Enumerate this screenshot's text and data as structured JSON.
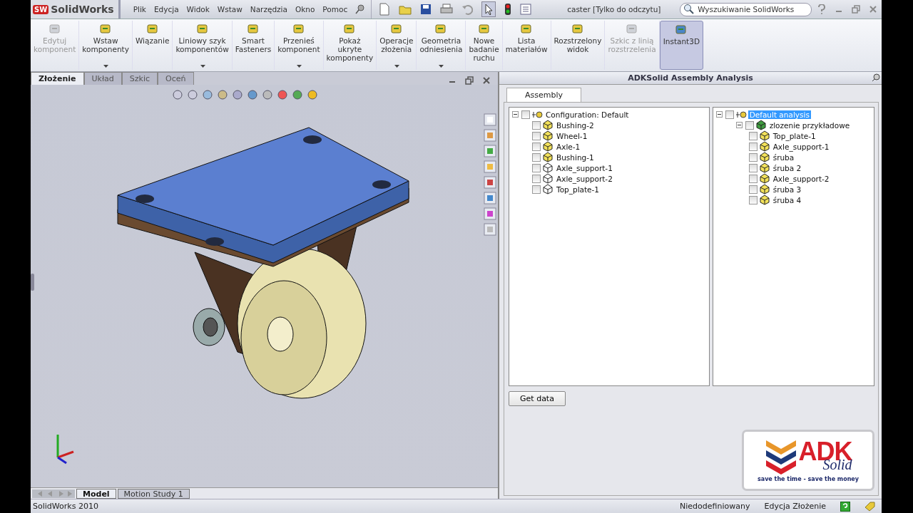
{
  "app": {
    "logo_badge": "SW",
    "logo": "SolidWorks",
    "menu": [
      "Plik",
      "Edycja",
      "Widok",
      "Wstaw",
      "Narzędzia",
      "Okno",
      "Pomoc"
    ],
    "title": "caster [Tylko do odczytu]",
    "search": {
      "placeholder": "Wyszukiwanie SolidWorks"
    }
  },
  "ribbon": [
    {
      "lines": [
        "Edytuj",
        "komponent"
      ],
      "disabled": true,
      "dropdown": false,
      "selected": false
    },
    {
      "lines": [
        "Wstaw",
        "komponenty"
      ],
      "disabled": false,
      "dropdown": true,
      "selected": false
    },
    {
      "lines": [
        "Wiązanie"
      ],
      "disabled": false,
      "dropdown": false,
      "selected": false
    },
    {
      "lines": [
        "Liniowy szyk",
        "komponentów"
      ],
      "disabled": false,
      "dropdown": true,
      "selected": false
    },
    {
      "lines": [
        "Smart",
        "Fasteners"
      ],
      "disabled": false,
      "dropdown": false,
      "selected": false
    },
    {
      "lines": [
        "Przenieś",
        "komponent"
      ],
      "disabled": false,
      "dropdown": true,
      "selected": false
    },
    {
      "lines": [
        "Pokaż",
        "ukryte",
        "komponenty"
      ],
      "disabled": false,
      "dropdown": false,
      "selected": false
    },
    {
      "lines": [
        "Operacje",
        "złożenia"
      ],
      "disabled": false,
      "dropdown": true,
      "selected": false
    },
    {
      "lines": [
        "Geometria",
        "odniesienia"
      ],
      "disabled": false,
      "dropdown": true,
      "selected": false
    },
    {
      "lines": [
        "Nowe",
        "badanie",
        "ruchu"
      ],
      "disabled": false,
      "dropdown": false,
      "selected": false
    },
    {
      "lines": [
        "Lista",
        "materiałów"
      ],
      "disabled": false,
      "dropdown": false,
      "selected": false
    },
    {
      "lines": [
        "Rozstrzelony",
        "widok"
      ],
      "disabled": false,
      "dropdown": false,
      "selected": false
    },
    {
      "lines": [
        "Szkic z linią",
        "rozstrzelenia"
      ],
      "disabled": true,
      "dropdown": false,
      "selected": false
    },
    {
      "lines": [
        "Instant3D"
      ],
      "disabled": false,
      "dropdown": false,
      "selected": true
    }
  ],
  "command_tabs": [
    {
      "label": "Złożenie",
      "selected": true
    },
    {
      "label": "Układ",
      "selected": false
    },
    {
      "label": "Szkic",
      "selected": false
    },
    {
      "label": "Oceń",
      "selected": false
    }
  ],
  "bottom_tabs": [
    {
      "label": "Model",
      "selected": true
    },
    {
      "label": "Motion Study 1",
      "selected": false
    }
  ],
  "panel": {
    "title": "ADKSolid Assembly Analysis",
    "tabs": [
      {
        "label": "Assembly",
        "selected": true
      }
    ],
    "left_tree": {
      "label": "Configuration: Default",
      "checked": false,
      "selected": false,
      "expanded": true,
      "children": [
        {
          "label": "Bushing-2",
          "kind": "shaded",
          "checked": false,
          "selected": false
        },
        {
          "label": "Wheel-1",
          "kind": "shaded",
          "checked": false,
          "selected": false
        },
        {
          "label": "Axle-1",
          "kind": "shaded",
          "checked": false,
          "selected": false
        },
        {
          "label": "Bushing-1",
          "kind": "shaded",
          "checked": false,
          "selected": false
        },
        {
          "label": "Axle_support-1",
          "kind": "outline",
          "checked": false,
          "selected": false
        },
        {
          "label": "Axle_support-2",
          "kind": "outline",
          "checked": false,
          "selected": false
        },
        {
          "label": "Top_plate-1",
          "kind": "outline",
          "checked": false,
          "selected": false
        }
      ]
    },
    "right_tree": {
      "label": "Default analysis",
      "checked": false,
      "selected": true,
      "expanded": true,
      "children": [
        {
          "label": "zlozenie przykładowe",
          "kind": "assembly",
          "checked": false,
          "selected": false,
          "expanded": true,
          "children": [
            {
              "label": "Top_plate-1",
              "kind": "shaded",
              "checked": false,
              "selected": false
            },
            {
              "label": "Axle_support-1",
              "kind": "shaded",
              "checked": false,
              "selected": false
            },
            {
              "label": "śruba",
              "kind": "shaded",
              "checked": false,
              "selected": false
            },
            {
              "label": "śruba 2",
              "kind": "shaded",
              "checked": false,
              "selected": false
            },
            {
              "label": "Axle_support-2",
              "kind": "shaded",
              "checked": false,
              "selected": false
            },
            {
              "label": "śruba 3",
              "kind": "shaded",
              "checked": false,
              "selected": false
            },
            {
              "label": "śruba 4",
              "kind": "shaded",
              "checked": false,
              "selected": false
            }
          ]
        }
      ]
    },
    "button": "Get data",
    "brand": {
      "name": "ADK",
      "sub": "Solid",
      "slogan": "save the time - save the money"
    }
  },
  "status_bar": {
    "product": "SolidWorks 2010",
    "state": "Niedodefiniowany",
    "mode": "Edycja Złożenie"
  }
}
